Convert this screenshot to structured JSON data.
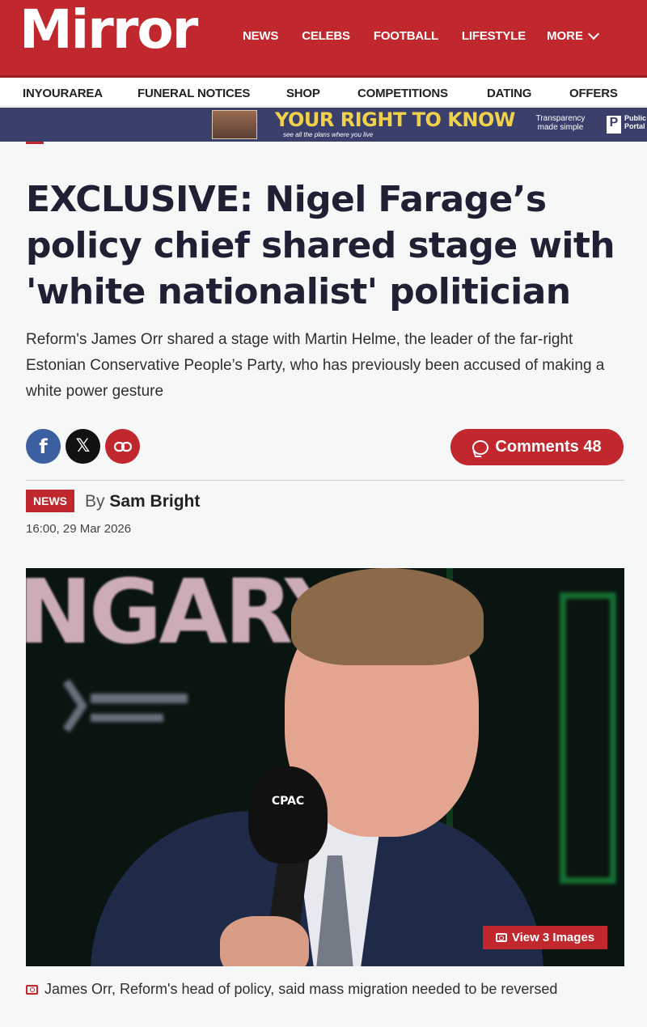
{
  "header": {
    "logo": "Mirror",
    "nav": [
      "NEWS",
      "CELEBS",
      "FOOTBALL",
      "LIFESTYLE"
    ],
    "more_label": "MORE"
  },
  "subnav": [
    "INYOURAREA",
    "FUNERAL NOTICES",
    "SHOP",
    "COMPETITIONS",
    "DATING",
    "OFFERS"
  ],
  "banner": {
    "slogan": "YOUR RIGHT TO KNOW",
    "subline": "see all the plans where you live",
    "tagline": "Transparency made simple",
    "brand": "Public Portal"
  },
  "article": {
    "headline": "EXCLUSIVE: Nigel Farage’s policy chief shared stage with 'white nationalist' politician",
    "standfirst": "Reform's James Orr shared a stage with Martin Helme, the leader of the far-right Estonian Conservative People’s Party, who has previously been accused of making a white power gesture",
    "comments_label": "Comments 48",
    "section_badge": "NEWS",
    "by_prefix": "By",
    "author": "Sam Bright",
    "timestamp": "16:00, 29 Mar 2026",
    "image_text": "NGARY",
    "mic_label": "CPAC",
    "view_images_label": "View 3 Images",
    "caption": "James Orr, Reform's head of policy, said mass migration needed to be reversed"
  },
  "colors": {
    "brand_red": "#c1282e",
    "facebook": "#3b5fa0",
    "x": "#111111",
    "headline": "#202034"
  },
  "icons": [
    "chevron-down-icon",
    "facebook-icon",
    "x-icon",
    "link-icon",
    "comment-icon",
    "camera-icon"
  ]
}
